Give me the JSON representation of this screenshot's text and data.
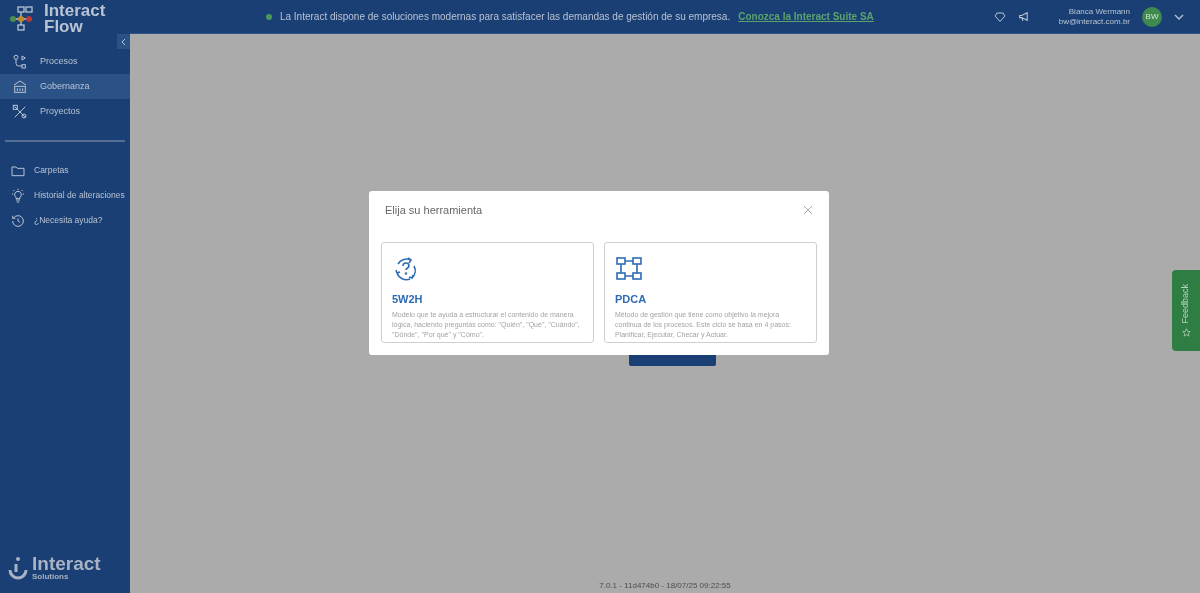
{
  "brand": {
    "line1": "Interact",
    "line2": "Flow"
  },
  "sidebar": {
    "items": [
      {
        "kind": "process",
        "label": "Procesos",
        "selected": false
      },
      {
        "kind": "governance",
        "label": "Gobernanza",
        "selected": true
      },
      {
        "kind": "projects",
        "label": "Proyectos",
        "selected": false
      }
    ],
    "secondary": [
      {
        "kind": "folder",
        "label": "Carpetas"
      },
      {
        "kind": "bulb",
        "label": "Historial de alteraciones"
      },
      {
        "kind": "history",
        "label": "¿Necesita ayuda?"
      }
    ],
    "footer_logo": {
      "name": "Interact",
      "sub": "Solutions"
    }
  },
  "topbar": {
    "announcement": "La Interact dispone de soluciones modernas para satisfacer las demandas de gestión de su empresa.",
    "link": "Conozca la Interact Suite SA",
    "user_name": "Bianca Wermann",
    "user_email": "bw@interact.com.br",
    "initials": "BW"
  },
  "modal": {
    "title": "Elija su herramienta",
    "options": [
      {
        "kind": "cycle",
        "title": "5W2H",
        "description": "Modelo que te ayuda a estructurar el contenido de manera lógica, haciendo preguntas como: \"Quién\", \"Qué\", \"Cuándo\", \"Dónde\", \"Por qué\" y \"Cómo\"."
      },
      {
        "kind": "blocks",
        "title": "PDCA",
        "description": "Método de gestión que tiene como objetivo la mejora continua de los procesos. Este ciclo se basa en 4 pasos: Planificar, Ejecutar, Checar y Actuar."
      }
    ]
  },
  "version": "7.0.1 - 11d474b0 - 18/07/25 09:22:55",
  "feedback": "Feedback"
}
